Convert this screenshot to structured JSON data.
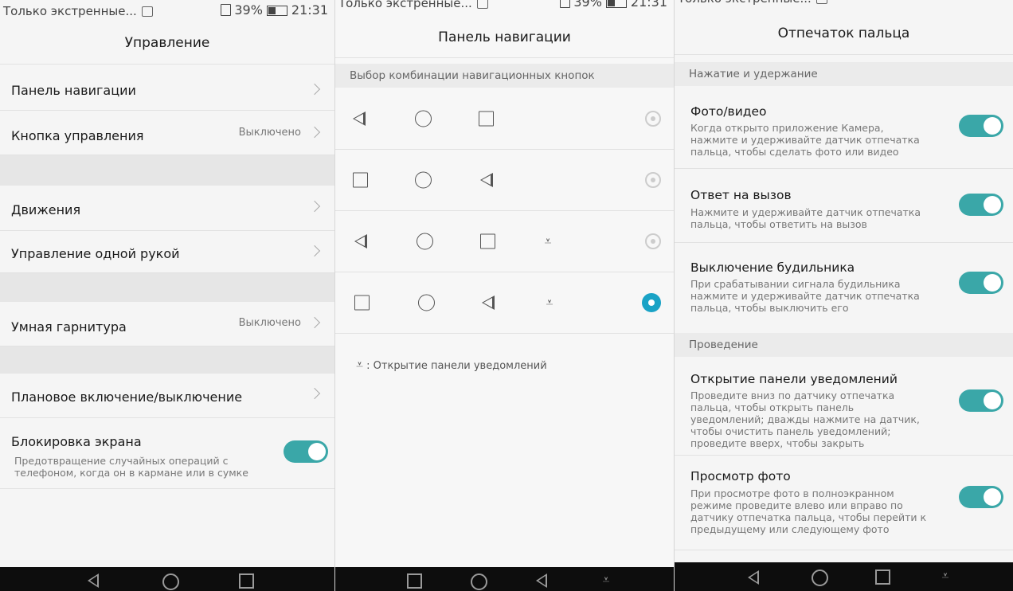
{
  "status": {
    "notice": "Только экстренные...",
    "battery": "39%",
    "time": "21:31"
  },
  "screen1": {
    "title": "Управление",
    "items": [
      {
        "label": "Панель навигации",
        "value": ""
      },
      {
        "label": "Кнопка управления",
        "value": "Выключено"
      },
      {
        "label": "Движения",
        "value": ""
      },
      {
        "label": "Управление одной рукой",
        "value": ""
      },
      {
        "label": "Умная гарнитура",
        "value": "Выключено"
      },
      {
        "label": "Плановое включение/выключение",
        "value": ""
      }
    ],
    "lock": {
      "title": "Блокировка экрана",
      "desc": "Предотвращение случайных операций с телефоном, когда он в кармане или в сумке",
      "enabled": true
    }
  },
  "screen2": {
    "title": "Панель навигации",
    "section": "Выбор комбинации навигационных кнопок",
    "combos": [
      {
        "icons": [
          "back-icon",
          "home-icon",
          "recents-icon"
        ],
        "selected": false
      },
      {
        "icons": [
          "recents-icon",
          "home-icon",
          "back-icon"
        ],
        "selected": false
      },
      {
        "icons": [
          "back-icon",
          "home-icon",
          "recents-icon",
          "notification-pull-icon"
        ],
        "selected": false
      },
      {
        "icons": [
          "recents-icon",
          "home-icon",
          "back-icon",
          "notification-pull-icon"
        ],
        "selected": true
      }
    ],
    "legend": ": Открытие панели уведомлений"
  },
  "screen3": {
    "title": "Отпечаток пальца",
    "section1": "Нажатие и удержание",
    "section2": "Проведение",
    "items": [
      {
        "title": "Фото/видео",
        "desc": "Когда открыто приложение Камера, нажмите и удерживайте датчик отпечатка пальца, чтобы сделать фото или видео",
        "enabled": true
      },
      {
        "title": "Ответ на вызов",
        "desc": "Нажмите и удерживайте датчик отпечатка пальца, чтобы ответить на вызов",
        "enabled": true
      },
      {
        "title": "Выключение будильника",
        "desc": "При срабатывании сигнала будильника нажмите и удерживайте датчик отпечатка пальца, чтобы выключить его",
        "enabled": true
      },
      {
        "title": "Открытие панели уведомлений",
        "desc": "Проведите вниз по датчику отпечатка пальца, чтобы открыть панель уведомлений; дважды нажмите на датчик, чтобы очистить панель уведомлений; проведите вверх, чтобы закрыть",
        "enabled": true
      },
      {
        "title": "Просмотр фото",
        "desc": "При просмотре фото в полноэкранном режиме проведите влево или вправо по датчику отпечатка пальца, чтобы перейти к предыдущему или следующему фото",
        "enabled": true
      }
    ]
  },
  "colors": {
    "accent": "#3aa7a8",
    "radio_selected": "#1aa3c6"
  }
}
